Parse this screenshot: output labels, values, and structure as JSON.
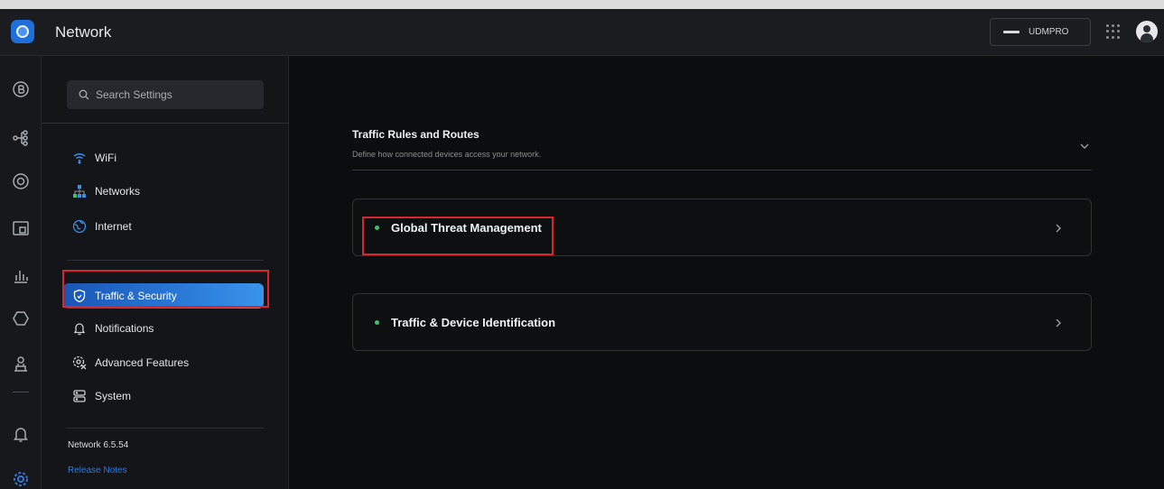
{
  "header": {
    "app_title": "Network",
    "device_name": "UDMPRO",
    "icons": [
      "app-logo-icon",
      "apps-grid-icon",
      "user-avatar-icon"
    ]
  },
  "rail": {
    "icons": [
      "dashboard-icon",
      "topology-icon",
      "devices-icon",
      "clients-icon",
      "statistics-icon",
      "insights-icon",
      "system-log-icon",
      "notifications-icon",
      "settings-icon"
    ]
  },
  "sidebar": {
    "search_placeholder": "Search Settings",
    "group1": [
      {
        "label": "WiFi",
        "icon": "wifi-icon"
      },
      {
        "label": "Networks",
        "icon": "networks-icon"
      },
      {
        "label": "Internet",
        "icon": "globe-icon"
      }
    ],
    "group2": [
      {
        "label": "Traffic & Security",
        "icon": "shield-icon",
        "active": true
      },
      {
        "label": "Notifications",
        "icon": "bell-icon"
      },
      {
        "label": "Advanced Features",
        "icon": "advanced-features-icon"
      },
      {
        "label": "System",
        "icon": "system-icon"
      }
    ],
    "version": "Network 6.5.54",
    "release_notes": "Release Notes"
  },
  "main": {
    "section_title": "Traffic Rules and Routes",
    "section_subtitle": "Define how connected devices access your network.",
    "cards": [
      {
        "label": "Global Threat Management",
        "status_color": "#39c26b"
      },
      {
        "label": "Traffic & Device Identification",
        "status_color": "#39c26b"
      }
    ]
  },
  "colors": {
    "accent": "#2a7ad8",
    "highlight_box": "#d8262c",
    "status_green": "#39c26b"
  }
}
